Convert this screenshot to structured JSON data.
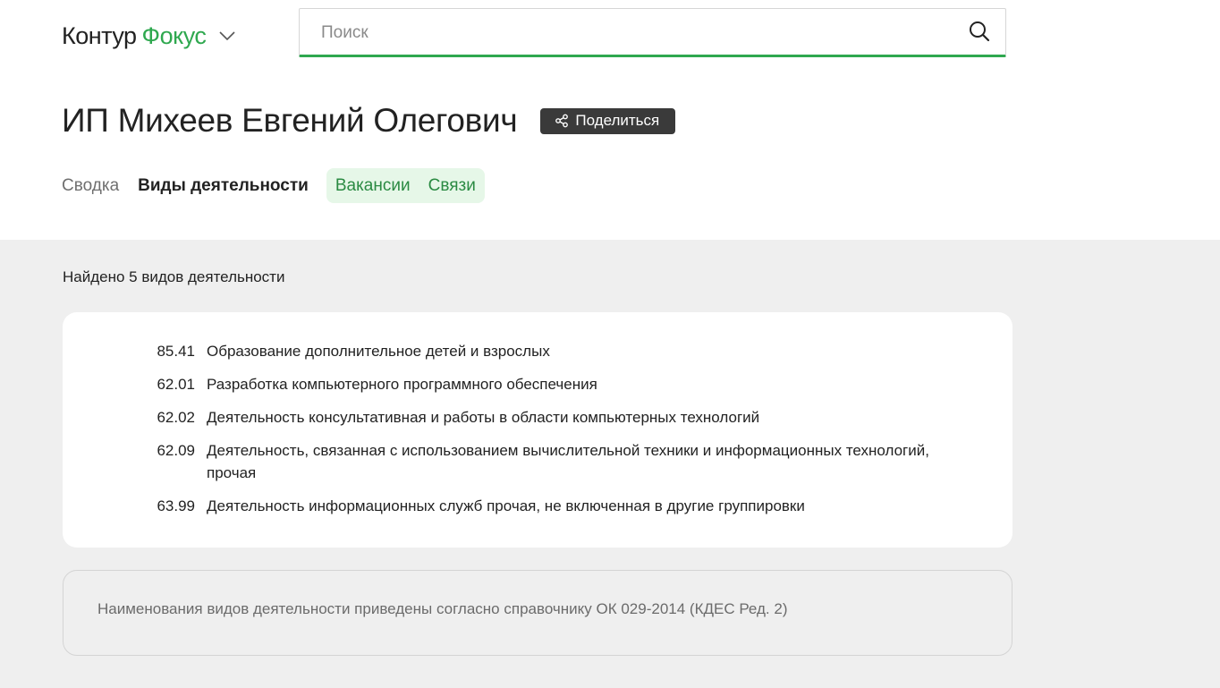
{
  "logo": {
    "left": "Контур",
    "right": "Фокус"
  },
  "search": {
    "placeholder": "Поиск",
    "value": ""
  },
  "company": {
    "title": "ИП Михеев Евгений Олегович",
    "share_label": "Поделиться"
  },
  "tabs": [
    {
      "label": "Сводка",
      "state": "inactive"
    },
    {
      "label": "Виды деятельности",
      "state": "active"
    },
    {
      "label": "Вакансии",
      "state": "highlighted"
    },
    {
      "label": "Связи",
      "state": "highlighted"
    }
  ],
  "activities": {
    "found_text": "Найдено 5 видов деятельности",
    "items": [
      {
        "code": "85.41",
        "name": "Образование дополнительное детей и взрослых"
      },
      {
        "code": "62.01",
        "name": "Разработка компьютерного программного обеспечения"
      },
      {
        "code": "62.02",
        "name": "Деятельность консультативная и работы в области компьютерных технологий"
      },
      {
        "code": "62.09",
        "name": "Деятельность, связанная с использованием вычислительной техники и информационных технологий, прочая"
      },
      {
        "code": "63.99",
        "name": "Деятельность информационных служб прочая, не включенная в другие группировки"
      }
    ]
  },
  "note": {
    "text": "Наименования видов деятельности приведены согласно справочнику ОК 029-2014 (КДЕС Ред. 2)"
  },
  "colors": {
    "brand_green": "#2fa84f",
    "tab_green_text": "#2a8a42",
    "tab_green_bg": "#e6f7e8",
    "share_bg": "#3a3a3a",
    "page_bg": "#efefef"
  },
  "icons": [
    "chevron-down-icon",
    "search-icon",
    "share-icon"
  ]
}
